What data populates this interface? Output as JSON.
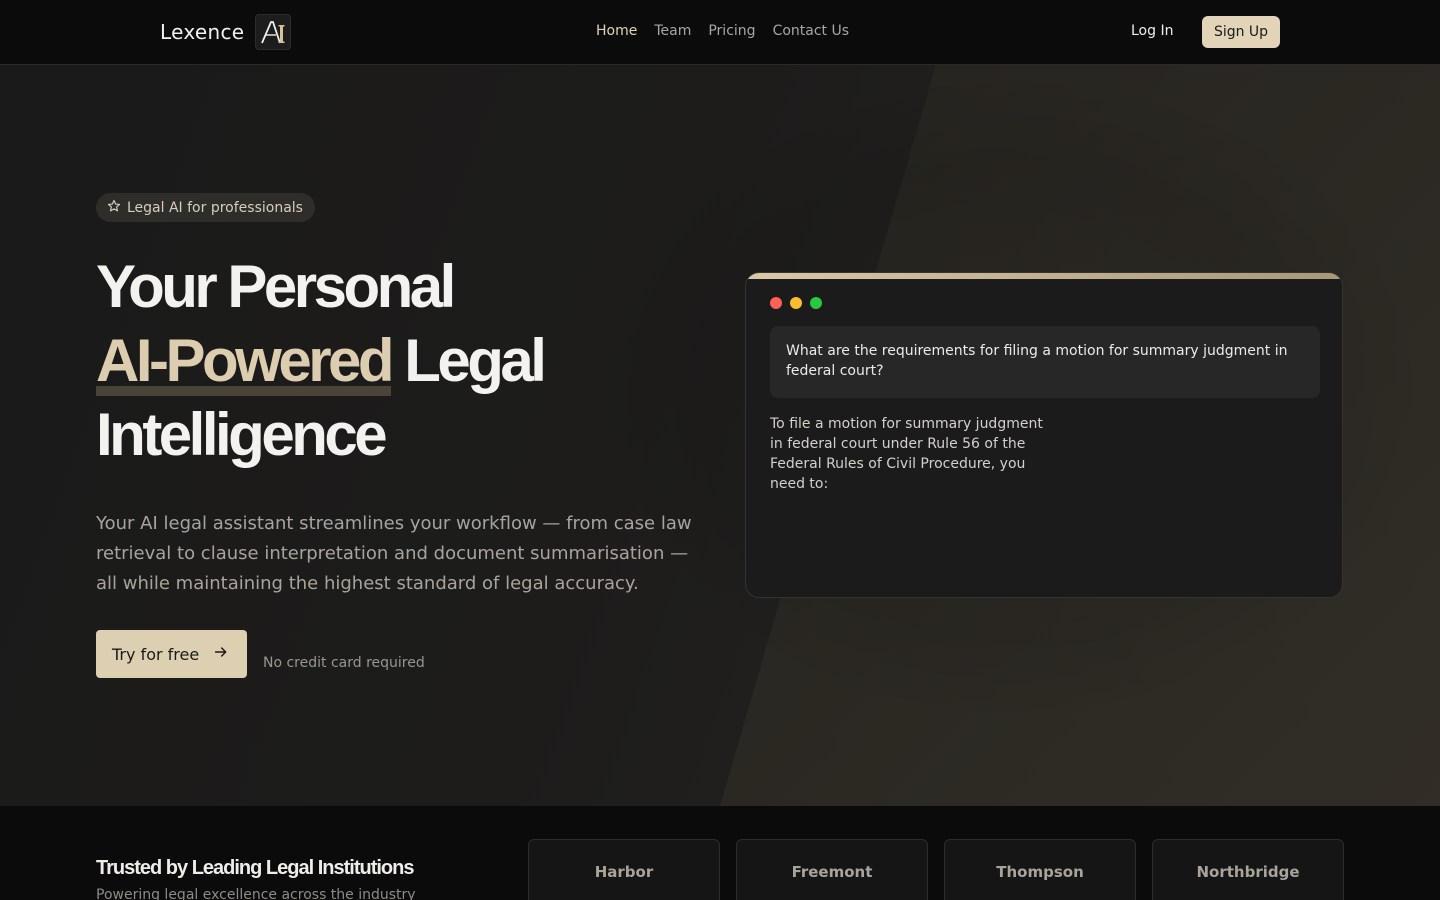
{
  "nav": {
    "brand": "Lexence",
    "links": [
      "Home",
      "Team",
      "Pricing",
      "Contact Us"
    ],
    "login": "Log In",
    "signup": "Sign Up"
  },
  "hero": {
    "badge": "Legal AI for professionals",
    "headline_line1": "Your Personal",
    "headline_accent": "AI-Powered",
    "headline_line2_rest": " Legal",
    "headline_line3": "Intelligence",
    "lede": "Your AI legal assistant streamlines your workflow — from case law retrieval to clause interpretation and document summarisation — all while maintaining the highest standard of legal accuracy.",
    "cta": "Try for free",
    "cta_note": "No credit card required"
  },
  "chat": {
    "window_dots": [
      "#ff5f57",
      "#febc2e",
      "#28c840"
    ],
    "question": "What are the requirements for filing a motion for summary judgment in federal court?",
    "answer": "To file a motion for summary judgment in federal court under Rule 56 of the Federal Rules of Civil Procedure, you need to:"
  },
  "trusted": {
    "title": "Trusted by Leading Legal Institutions",
    "subtitle": "Powering legal excellence across the industry",
    "logos": [
      "Harbor",
      "Freemont",
      "Thompson",
      "Northbridge"
    ]
  },
  "colors": {
    "accent": "#e2d4b8",
    "background": "#0f0f0f"
  },
  "icons": {
    "badge": "star-icon",
    "cta": "arrow-right-icon",
    "logo": "ai-monogram-icon"
  }
}
